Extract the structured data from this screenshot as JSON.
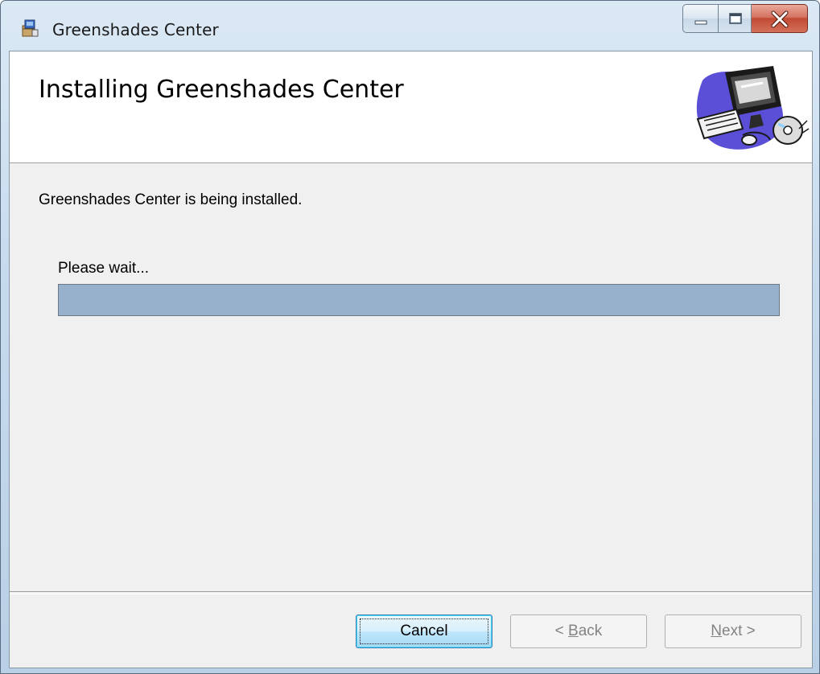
{
  "window": {
    "title": "Greenshades Center",
    "icon": "installer-package-icon"
  },
  "caption_buttons": {
    "minimize": "minimize-icon",
    "maximize": "maximize-icon",
    "close": "close-icon"
  },
  "banner": {
    "title": "Installing Greenshades Center",
    "art": "computer-cd-clipart"
  },
  "body": {
    "status": "Greenshades Center is being installed.",
    "wait_label": "Please wait...",
    "progress_fraction": 1.0
  },
  "buttons": {
    "cancel": "Cancel",
    "back_arrow": "< ",
    "back_mnemonic": "B",
    "back_rest": "ack",
    "next_mnemonic": "N",
    "next_rest": "ext >"
  },
  "colors": {
    "progress_fill": "#97b0cb",
    "client_bg": "#f0f0f0"
  }
}
